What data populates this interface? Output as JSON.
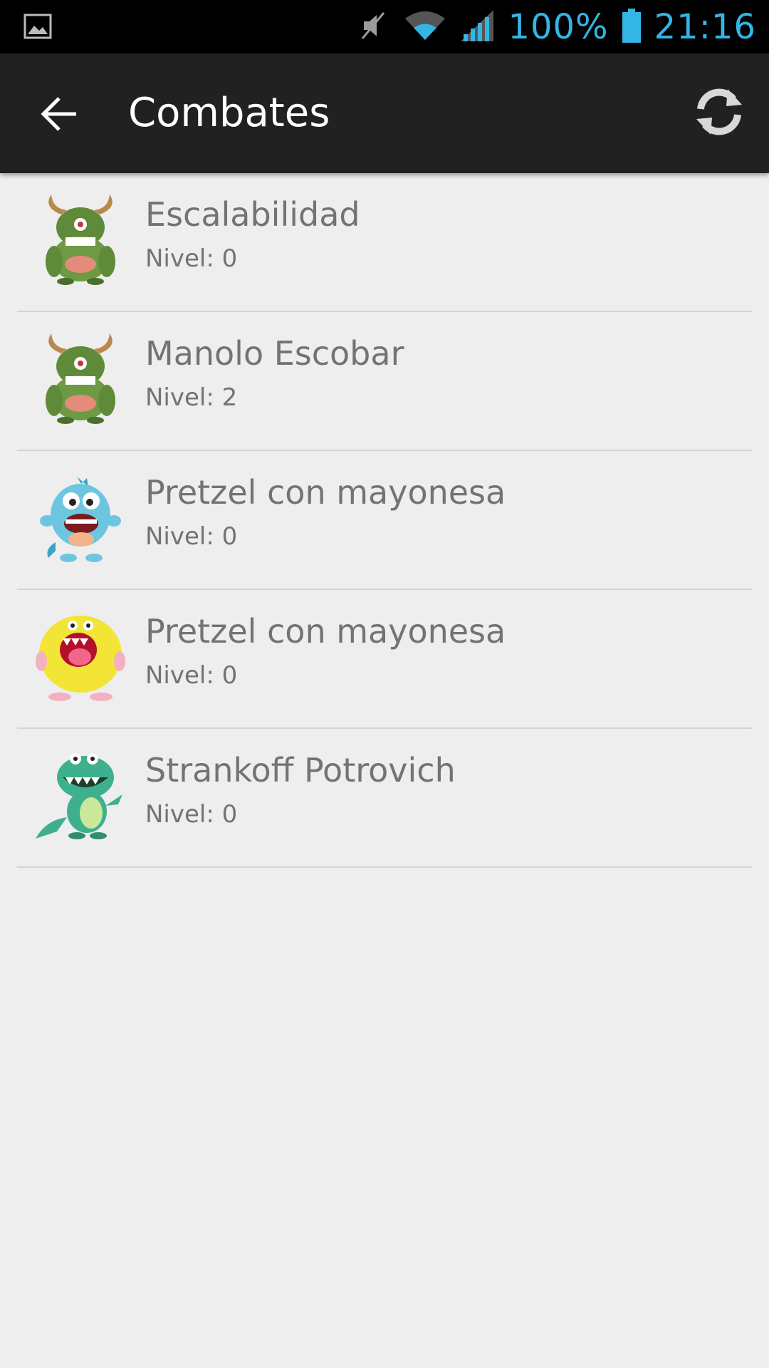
{
  "status_bar": {
    "battery": "100%",
    "time": "21:16",
    "accent": "#33b5e5"
  },
  "app_bar": {
    "title": "Combates",
    "back_icon": "arrow-back-icon",
    "refresh_icon": "refresh-icon"
  },
  "combats": [
    {
      "name": "Escalabilidad",
      "level": "Nivel: 0",
      "avatar": "green-horned-monster"
    },
    {
      "name": "Manolo Escobar",
      "level": "Nivel: 2",
      "avatar": "green-horned-monster"
    },
    {
      "name": "Pretzel con mayonesa",
      "level": "Nivel: 0",
      "avatar": "blue-monster"
    },
    {
      "name": "Pretzel con mayonesa",
      "level": "Nivel: 0",
      "avatar": "yellow-furry-monster"
    },
    {
      "name": "Strankoff Potrovich",
      "level": "Nivel: 0",
      "avatar": "green-dragon-monster"
    }
  ]
}
